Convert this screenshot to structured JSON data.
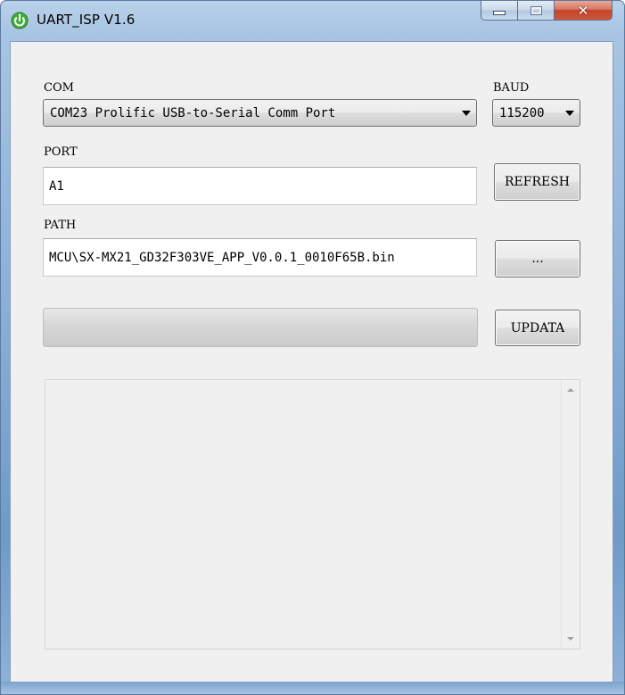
{
  "window": {
    "title": "UART_ISP V1.6",
    "icon": "power-icon",
    "controls": {
      "minimize": "minimize-icon",
      "maximize": "maximize-icon",
      "close": "close-icon",
      "close_label": "✕"
    }
  },
  "form": {
    "com": {
      "label": "COM",
      "value": "COM23 Prolific USB-to-Serial Comm Port"
    },
    "baud": {
      "label": "BAUD",
      "value": "115200"
    },
    "port": {
      "label": "PORT",
      "value": "A1"
    },
    "refresh_label": "REFRESH",
    "path": {
      "label": "PATH",
      "value": "MCU\\SX-MX21_GD32F303VE_APP_V0.0.1_0010F65B.bin"
    },
    "browse_label": "...",
    "progress": {
      "percent": 0
    },
    "update_label": "UPDATA"
  },
  "log": {
    "text": ""
  },
  "colors": {
    "title_bar": "#b9d1ea",
    "client_bg": "#f0f0f0",
    "close_button": "#c2442a",
    "app_icon": "#3fae3a"
  }
}
